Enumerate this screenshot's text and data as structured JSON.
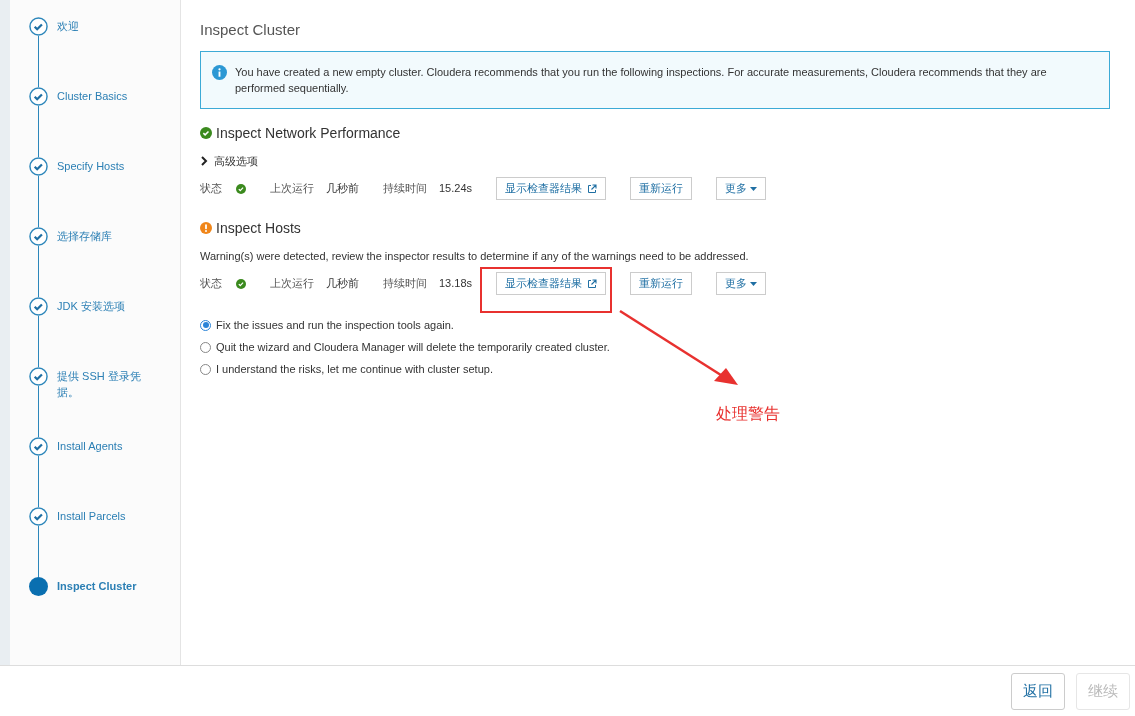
{
  "steps": [
    {
      "label": "欢迎",
      "selected": false
    },
    {
      "label": "Cluster Basics",
      "selected": false
    },
    {
      "label": "Specify Hosts",
      "selected": false
    },
    {
      "label": "选择存储库",
      "selected": false
    },
    {
      "label": "JDK 安装选项",
      "selected": false
    },
    {
      "label": "提供 SSH 登录凭据。",
      "selected": false
    },
    {
      "label": "Install Agents",
      "selected": false
    },
    {
      "label": "Install Parcels",
      "selected": false
    },
    {
      "label": "Inspect Cluster",
      "selected": true
    }
  ],
  "page_title": "Inspect Cluster",
  "info_message": "You have created a new empty cluster. Cloudera recommends that you run the following inspections. For accurate measurements, Cloudera recommends that they are performed sequentially.",
  "inspections": [
    {
      "title": "Inspect Network Performance",
      "kind": "success",
      "advanced_options": "高级选项",
      "status_label": "状态",
      "status_ok": true,
      "last_run_label": "上次运行",
      "last_run": "几秒前",
      "duration_label": "持续时间",
      "duration": "15.24s",
      "show_results": "显示检查器结果",
      "rerun": "重新运行",
      "more": "更多"
    },
    {
      "title": "Inspect Hosts",
      "kind": "warning",
      "warning_text": "Warning(s) were detected, review the inspector results to determine if any of the warnings need to be addressed.",
      "status_label": "状态",
      "status_ok": true,
      "last_run_label": "上次运行",
      "last_run": "几秒前",
      "duration_label": "持续时间",
      "duration": "13.18s",
      "show_results": "显示检查器结果",
      "rerun": "重新运行",
      "more": "更多"
    }
  ],
  "options": [
    {
      "label": "Fix the issues and run the inspection tools again.",
      "selected": true
    },
    {
      "label": "Quit the wizard and Cloudera Manager will delete the temporarily created cluster.",
      "selected": false
    },
    {
      "label": "I understand the risks, let me continue with cluster setup.",
      "selected": false
    }
  ],
  "annotation": {
    "label": "处理警告"
  },
  "footer_buttons": [
    {
      "label": "返回",
      "disabled": false
    },
    {
      "label": "继续",
      "disabled": true
    }
  ]
}
